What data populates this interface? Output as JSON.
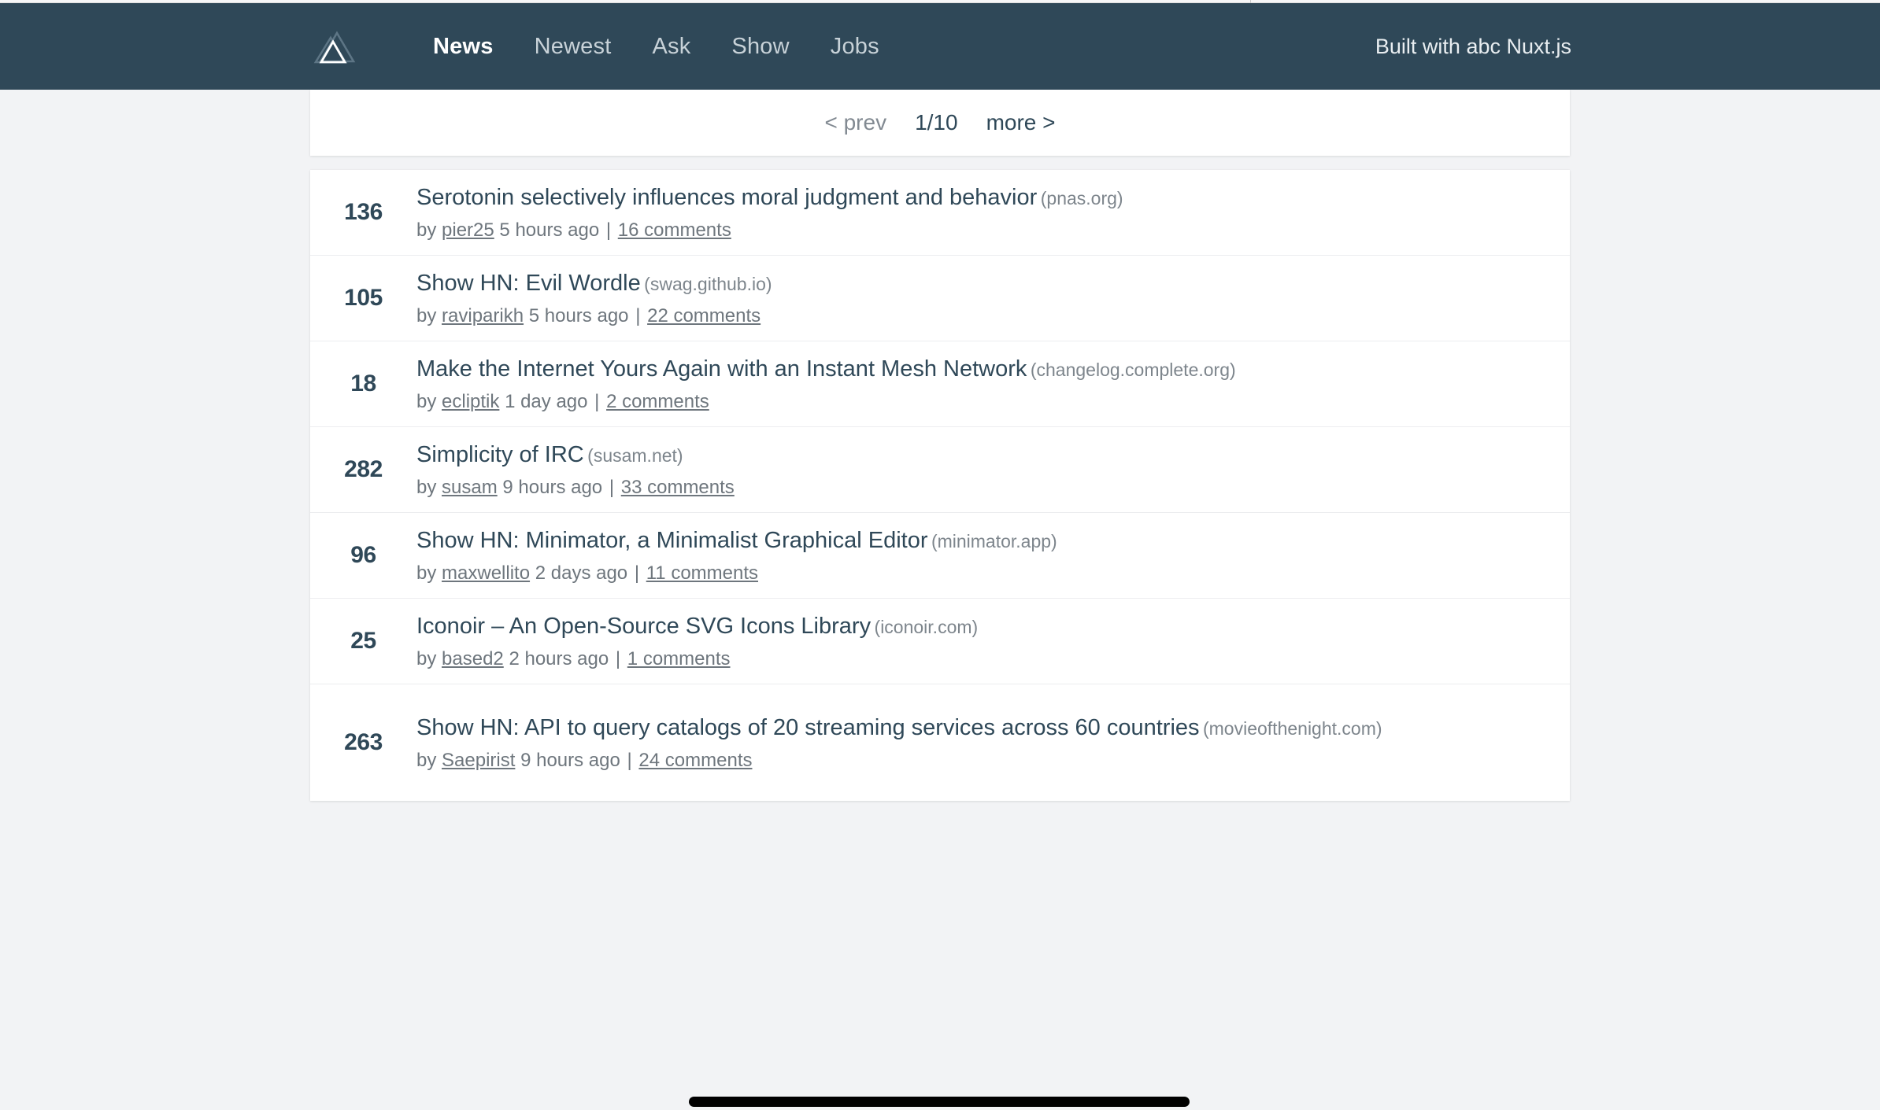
{
  "navbar": {
    "logo_name": "nuxt-logo",
    "links": [
      {
        "label": "News",
        "active": true
      },
      {
        "label": "Newest",
        "active": false
      },
      {
        "label": "Ask",
        "active": false
      },
      {
        "label": "Show",
        "active": false
      },
      {
        "label": "Jobs",
        "active": false
      }
    ],
    "built_with": "Built with abc Nuxt.js",
    "background": "#2f4858"
  },
  "pagination": {
    "prev_label": "< prev",
    "current": "1/10",
    "more_label": "more >"
  },
  "news": [
    {
      "score": "136",
      "title": "Serotonin selectively influences moral judgment and behavior",
      "host": "(pnas.org)",
      "by_label": "by",
      "author": "pier25",
      "time": "5 hours ago",
      "sep": "|",
      "comments": "16 comments"
    },
    {
      "score": "105",
      "title": "Show HN: Evil Wordle",
      "host": "(swag.github.io)",
      "by_label": "by",
      "author": "raviparikh",
      "time": "5 hours ago",
      "sep": "|",
      "comments": "22 comments"
    },
    {
      "score": "18",
      "title": "Make the Internet Yours Again with an Instant Mesh Network",
      "host": "(changelog.complete.org)",
      "by_label": "by",
      "author": "ecliptik",
      "time": "1 day ago",
      "sep": "|",
      "comments": "2 comments"
    },
    {
      "score": "282",
      "title": "Simplicity of IRC",
      "host": "(susam.net)",
      "by_label": "by",
      "author": "susam",
      "time": "9 hours ago",
      "sep": "|",
      "comments": "33 comments"
    },
    {
      "score": "96",
      "title": "Show HN: Minimator, a Minimalist Graphical Editor",
      "host": "(minimator.app)",
      "by_label": "by",
      "author": "maxwellito",
      "time": "2 days ago",
      "sep": "|",
      "comments": "11 comments"
    },
    {
      "score": "25",
      "title": "Iconoir – An Open-Source SVG Icons Library",
      "host": "(iconoir.com)",
      "by_label": "by",
      "author": "based2",
      "time": "2 hours ago",
      "sep": "|",
      "comments": "1 comments"
    },
    {
      "score": "263",
      "title": "Show HN: API to query catalogs of 20 streaming services across 60 countries",
      "host": "(movieofthenight.com)",
      "by_label": "by",
      "author": "Saepirist",
      "time": "9 hours ago",
      "sep": "|",
      "comments": "24 comments"
    }
  ],
  "colors": {
    "navbar_bg": "#2f4858",
    "page_bg": "#f2f3f5",
    "accent_text": "#2f4858",
    "muted_text": "#6e767d",
    "scrollbar_thumb": "#000000"
  }
}
